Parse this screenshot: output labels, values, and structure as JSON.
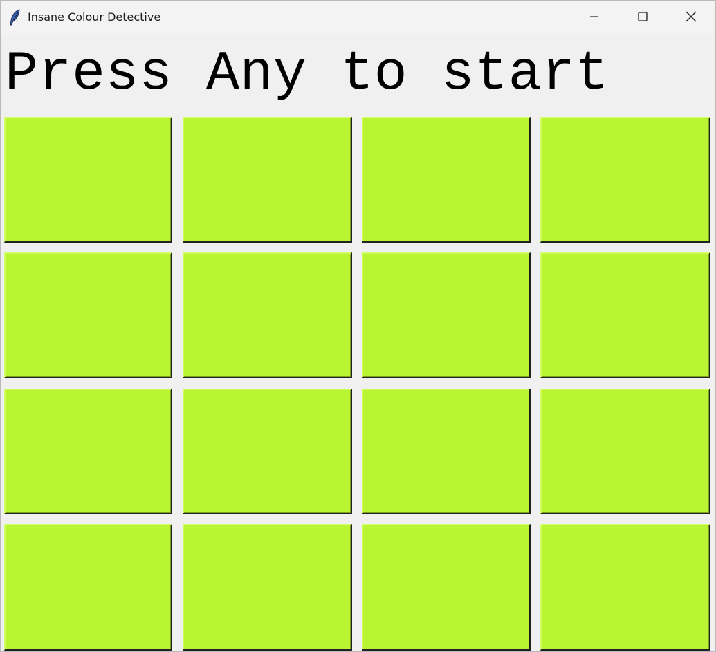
{
  "window": {
    "title": "Insane Colour Detective",
    "app_icon": "feather-icon",
    "controls": {
      "minimize_icon": "minimize-icon",
      "maximize_icon": "maximize-icon",
      "close_icon": "close-icon"
    }
  },
  "game": {
    "prompt": "Press Any to start",
    "grid_rows": 4,
    "grid_cols": 4,
    "tile_color": "#b9f533",
    "tiles": [
      {
        "row": 1,
        "col": 1
      },
      {
        "row": 1,
        "col": 2
      },
      {
        "row": 1,
        "col": 3
      },
      {
        "row": 1,
        "col": 4
      },
      {
        "row": 2,
        "col": 1
      },
      {
        "row": 2,
        "col": 2
      },
      {
        "row": 2,
        "col": 3
      },
      {
        "row": 2,
        "col": 4
      },
      {
        "row": 3,
        "col": 1
      },
      {
        "row": 3,
        "col": 2
      },
      {
        "row": 3,
        "col": 3
      },
      {
        "row": 3,
        "col": 4
      },
      {
        "row": 4,
        "col": 1
      },
      {
        "row": 4,
        "col": 2
      },
      {
        "row": 4,
        "col": 3
      },
      {
        "row": 4,
        "col": 4
      }
    ]
  }
}
